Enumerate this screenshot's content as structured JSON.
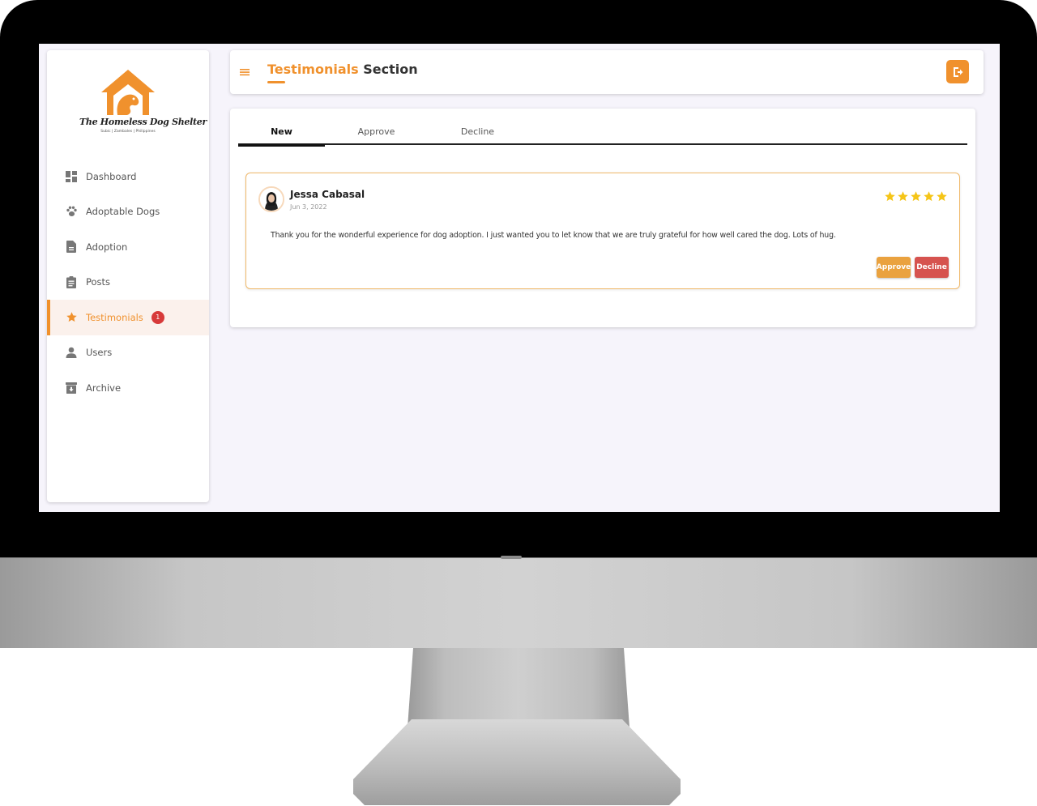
{
  "brand": {
    "title": "The Homeless Dog Shelter",
    "subtitle": "Subic | Zambales | Philippines",
    "accent_color": "#f0912d"
  },
  "sidebar": {
    "items": [
      {
        "label": "Dashboard",
        "icon": "dashboard-icon"
      },
      {
        "label": "Adoptable Dogs",
        "icon": "paw-icon"
      },
      {
        "label": "Adoption",
        "icon": "document-icon"
      },
      {
        "label": "Posts",
        "icon": "clipboard-icon"
      },
      {
        "label": "Testimonials",
        "icon": "star-icon",
        "active": true,
        "badge": "1"
      },
      {
        "label": "Users",
        "icon": "user-icon"
      },
      {
        "label": "Archive",
        "icon": "archive-icon"
      }
    ]
  },
  "header": {
    "title_accent": "Testimonials",
    "title_rest": " Section",
    "logout_icon": "logout-icon"
  },
  "tabs": [
    {
      "label": "New",
      "active": true
    },
    {
      "label": "Approve"
    },
    {
      "label": "Decline"
    }
  ],
  "testimonials": [
    {
      "author": "Jessa Cabasal",
      "date": "Jun 3, 2022",
      "rating": 5,
      "text": "Thank you for the wonderful experience for dog adoption. I just wanted you to let know that we are truly grateful for how well cared the dog. Lots of hug.",
      "approve_label": "Approve",
      "decline_label": "Decline"
    }
  ],
  "colors": {
    "approve": "#eaa23f",
    "decline": "#d6534f",
    "star": "#f5c518",
    "badge": "#d73a3a"
  }
}
